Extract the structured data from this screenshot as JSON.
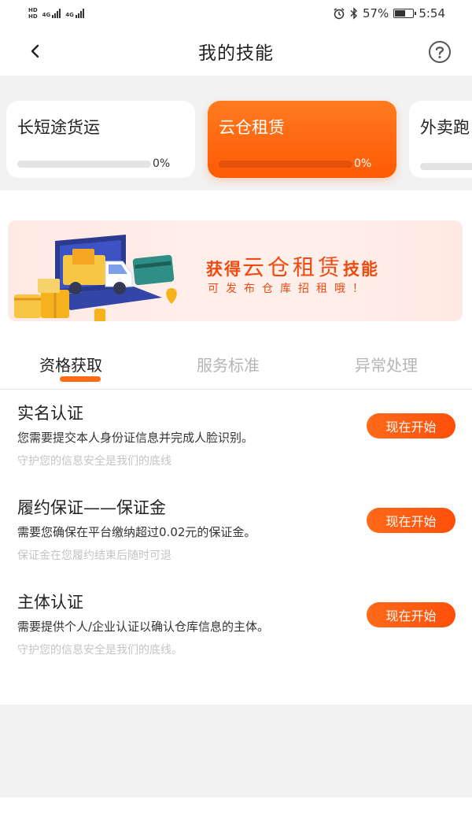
{
  "status_bar": {
    "hd1": "HD",
    "hd2": "HD",
    "net1": "4G",
    "net2": "4G",
    "battery_text": "57%",
    "battery_level": 0.57,
    "time": "5:54",
    "icons": [
      "alarm-icon",
      "bluetooth-icon",
      "battery-icon"
    ]
  },
  "nav": {
    "title": "我的技能",
    "back_icon": "chevron-left-icon",
    "help_icon": "question-circle-icon"
  },
  "skills": [
    {
      "name": "长短途货运",
      "progress": "0%",
      "active": false
    },
    {
      "name": "云仓租赁",
      "progress": "0%",
      "active": true
    },
    {
      "name": "外卖跑",
      "progress": "",
      "active": false
    }
  ],
  "banner": {
    "line1_prefix": "获得",
    "line1_highlight": "云仓租赁",
    "line1_suffix": "技能",
    "line2": "可发布仓库招租哦！"
  },
  "tabs": [
    {
      "label": "资格获取",
      "active": true
    },
    {
      "label": "服务标准",
      "active": false
    },
    {
      "label": "异常处理",
      "active": false
    }
  ],
  "items": [
    {
      "title": "实名认证",
      "desc": "您需要提交本人身份证信息并完成人脸识别。",
      "sub": "守护您的信息安全是我们的底线",
      "button": "现在开始"
    },
    {
      "title": "履约保证——保证金",
      "desc": "需要您确保在平台缴纳超过0.02元的保证金。",
      "sub": "保证金在您履约结束后随时可退",
      "button": "现在开始"
    },
    {
      "title": "主体认证",
      "desc": "需要提供个人/企业认证以确认仓库信息的主体。",
      "sub": "守护您的信息安全是我们的底线。",
      "button": "现在开始"
    }
  ],
  "colors": {
    "accent": "#ff5a06",
    "banner_text": "#ef4a10"
  }
}
